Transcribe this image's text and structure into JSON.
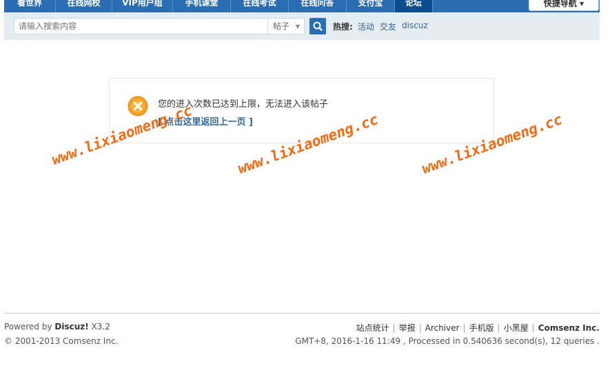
{
  "nav": {
    "items": [
      "看世界",
      "在线网校",
      "VIP用户组",
      "手机课堂",
      "在线考试",
      "在线问答",
      "支付宝",
      "论坛"
    ],
    "quick_nav": "快捷导航 ▾"
  },
  "search": {
    "placeholder": "请输入搜索内容",
    "type": "帖子",
    "hot_label": "热搜:",
    "hot_links": [
      "活动",
      "交友",
      "discuz"
    ]
  },
  "message": {
    "text": "您的进入次数已达到上限，无法进入该帖子",
    "back_link": "[ 点击这里返回上一页 ]"
  },
  "watermark": "www.lixiaomeng.cc",
  "footer": {
    "powered_prefix": "Powered by",
    "powered_brand": "Discuz!",
    "version": "X3.2",
    "copyright": "© 2001-2013 Comsenz Inc.",
    "links": [
      "站点统计",
      "举报",
      "Archiver",
      "手机版",
      "小黑屋"
    ],
    "company": "Comsenz Inc.",
    "processed": "GMT+8, 2016-1-16 11:49 , Processed in 0.540636 second(s), 12 queries ."
  },
  "colors": {
    "nav_bg": "#2b6db2",
    "link": "#336699",
    "watermark": "#f46a13",
    "error_icon": "#f4a023"
  }
}
